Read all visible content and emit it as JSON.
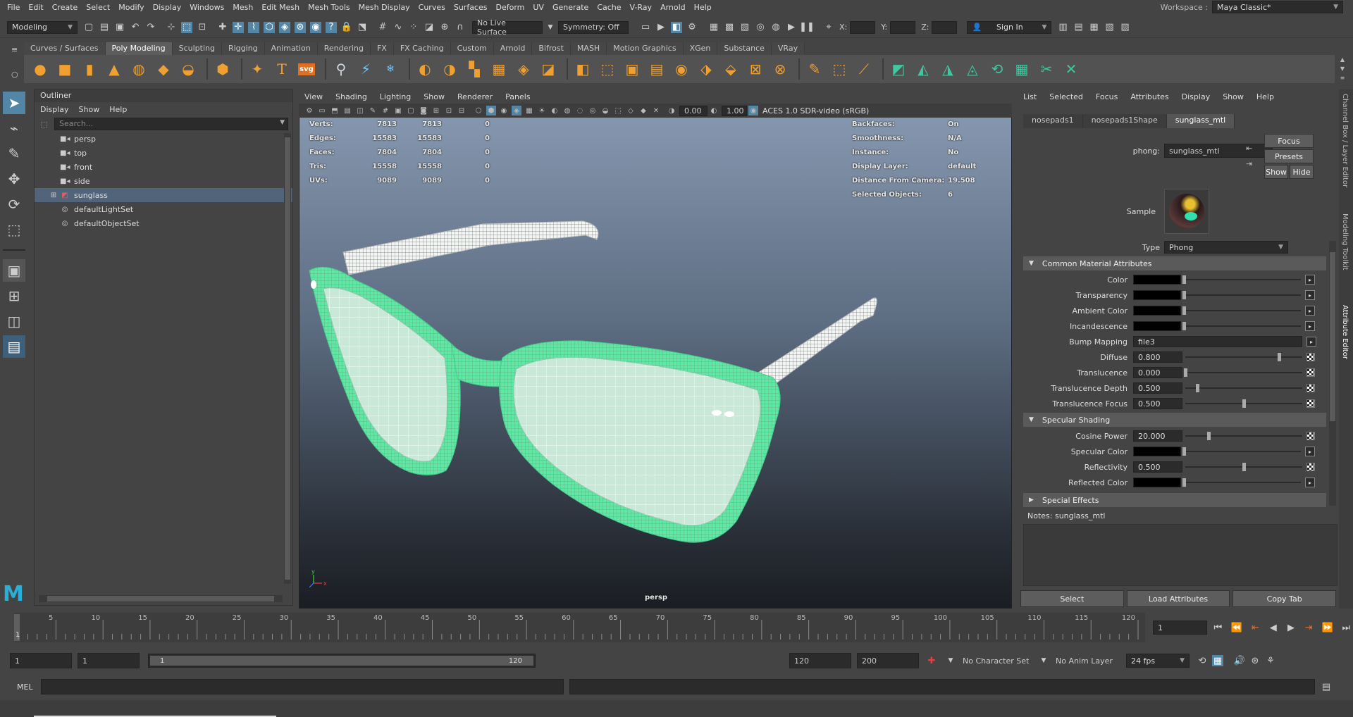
{
  "menubar": {
    "items": [
      "File",
      "Edit",
      "Create",
      "Select",
      "Modify",
      "Display",
      "Windows",
      "Mesh",
      "Edit Mesh",
      "Mesh Tools",
      "Mesh Display",
      "Curves",
      "Surfaces",
      "Deform",
      "UV",
      "Generate",
      "Cache",
      "V-Ray",
      "Arnold",
      "Help"
    ],
    "workspace_label": "Workspace :",
    "workspace_value": "Maya Classic*"
  },
  "statusline": {
    "mode": "Modeling",
    "live_surface": "No Live Surface",
    "symmetry": "Symmetry: Off",
    "x_label": "X:",
    "y_label": "Y:",
    "z_label": "Z:",
    "sign_in": "Sign In"
  },
  "shelf": {
    "tabs": [
      "Curves / Surfaces",
      "Poly Modeling",
      "Sculpting",
      "Rigging",
      "Animation",
      "Rendering",
      "FX",
      "FX Caching",
      "Custom",
      "Arnold",
      "Bifrost",
      "MASH",
      "Motion Graphics",
      "XGen",
      "Substance",
      "VRay"
    ],
    "active_tab": "Poly Modeling",
    "text_icon": "T",
    "svg_icon": "svg"
  },
  "outliner": {
    "title": "Outliner",
    "menu": [
      "Display",
      "Show",
      "Help"
    ],
    "search_placeholder": "Search...",
    "items": [
      {
        "label": "persp",
        "icon": "camera-icon"
      },
      {
        "label": "top",
        "icon": "camera-icon"
      },
      {
        "label": "front",
        "icon": "camera-icon"
      },
      {
        "label": "side",
        "icon": "camera-icon"
      },
      {
        "label": "sunglass",
        "icon": "mesh-icon"
      },
      {
        "label": "defaultLightSet",
        "icon": "set-icon"
      },
      {
        "label": "defaultObjectSet",
        "icon": "set-icon"
      }
    ],
    "selected_item": "sunglass"
  },
  "viewport": {
    "menu": [
      "View",
      "Shading",
      "Lighting",
      "Show",
      "Renderer",
      "Panels"
    ],
    "exposure": "0.00",
    "gamma": "1.00",
    "color_space": "ACES 1.0 SDR-video (sRGB)",
    "camera_label": "persp",
    "hud_left": [
      {
        "label": "Verts:",
        "a": "7813",
        "b": "7813",
        "c": "0"
      },
      {
        "label": "Edges:",
        "a": "15583",
        "b": "15583",
        "c": "0"
      },
      {
        "label": "Faces:",
        "a": "7804",
        "b": "7804",
        "c": "0"
      },
      {
        "label": "Tris:",
        "a": "15558",
        "b": "15558",
        "c": "0"
      },
      {
        "label": "UVs:",
        "a": "9089",
        "b": "9089",
        "c": "0"
      }
    ],
    "hud_right": [
      {
        "label": "Backfaces:",
        "value": "On"
      },
      {
        "label": "Smoothness:",
        "value": "N/A"
      },
      {
        "label": "Instance:",
        "value": "No"
      },
      {
        "label": "Display Layer:",
        "value": "default"
      },
      {
        "label": "Distance From Camera:",
        "value": "19.508"
      },
      {
        "label": "Selected Objects:",
        "value": "6"
      }
    ],
    "mesh_color": "#5fe8a4"
  },
  "attribute_editor": {
    "menu": [
      "List",
      "Selected",
      "Focus",
      "Attributes",
      "Display",
      "Show",
      "Help"
    ],
    "node_tabs": [
      "nosepads1",
      "nosepads1Shape",
      "sunglass_mtl"
    ],
    "active_tab": "sunglass_mtl",
    "node_type_label": "phong:",
    "node_name": "sunglass_mtl",
    "focus_btn": "Focus",
    "presets_btn": "Presets",
    "show_btn": "Show",
    "hide_btn": "Hide",
    "sample_label": "Sample",
    "type_label": "Type",
    "type_value": "Phong",
    "sections": {
      "common": "Common Material Attributes",
      "specular": "Specular Shading",
      "special": "Special Effects"
    },
    "common_attrs": [
      {
        "label": "Color",
        "kind": "swatch",
        "level": 0
      },
      {
        "label": "Transparency",
        "kind": "swatch",
        "level": 0
      },
      {
        "label": "Ambient Color",
        "kind": "swatch",
        "level": 0
      },
      {
        "label": "Incandescence",
        "kind": "swatch",
        "level": 0
      },
      {
        "label": "Bump Mapping",
        "kind": "text",
        "value": "file3"
      },
      {
        "label": "Diffuse",
        "kind": "num",
        "value": "0.800",
        "level": 0.8
      },
      {
        "label": "Translucence",
        "kind": "num",
        "value": "0.000",
        "level": 0.0
      },
      {
        "label": "Translucence Depth",
        "kind": "num",
        "value": "0.500",
        "level": 0.1
      },
      {
        "label": "Translucence Focus",
        "kind": "num",
        "value": "0.500",
        "level": 0.5
      }
    ],
    "specular_attrs": [
      {
        "label": "Cosine Power",
        "kind": "num",
        "value": "20.000",
        "level": 0.2
      },
      {
        "label": "Specular Color",
        "kind": "swatch",
        "level": 0
      },
      {
        "label": "Reflectivity",
        "kind": "num",
        "value": "0.500",
        "level": 0.5
      },
      {
        "label": "Reflected Color",
        "kind": "swatch",
        "level": 0
      }
    ],
    "notes_label": "Notes:  sunglass_mtl",
    "bottom_buttons": [
      "Select",
      "Load Attributes",
      "Copy Tab"
    ],
    "side_tabs": [
      "Channel Box / Layer Editor",
      "Modeling Toolkit",
      "Attribute Editor"
    ]
  },
  "timeline": {
    "ticks": [
      "5",
      "10",
      "15",
      "20",
      "25",
      "30",
      "35",
      "40",
      "45",
      "50",
      "55",
      "60",
      "65",
      "70",
      "75",
      "80",
      "85",
      "90",
      "95",
      "100",
      "105",
      "110",
      "115",
      "120"
    ],
    "current_frame_marker": "1",
    "current_frame": "1"
  },
  "range": {
    "start": "1",
    "playback_start": "1",
    "slider_start": "1",
    "slider_end": "120",
    "playback_end": "120",
    "end": "200",
    "character_set": "No Character Set",
    "anim_layer": "No Anim Layer",
    "fps": "24 fps"
  },
  "commandline": {
    "label": "MEL"
  }
}
